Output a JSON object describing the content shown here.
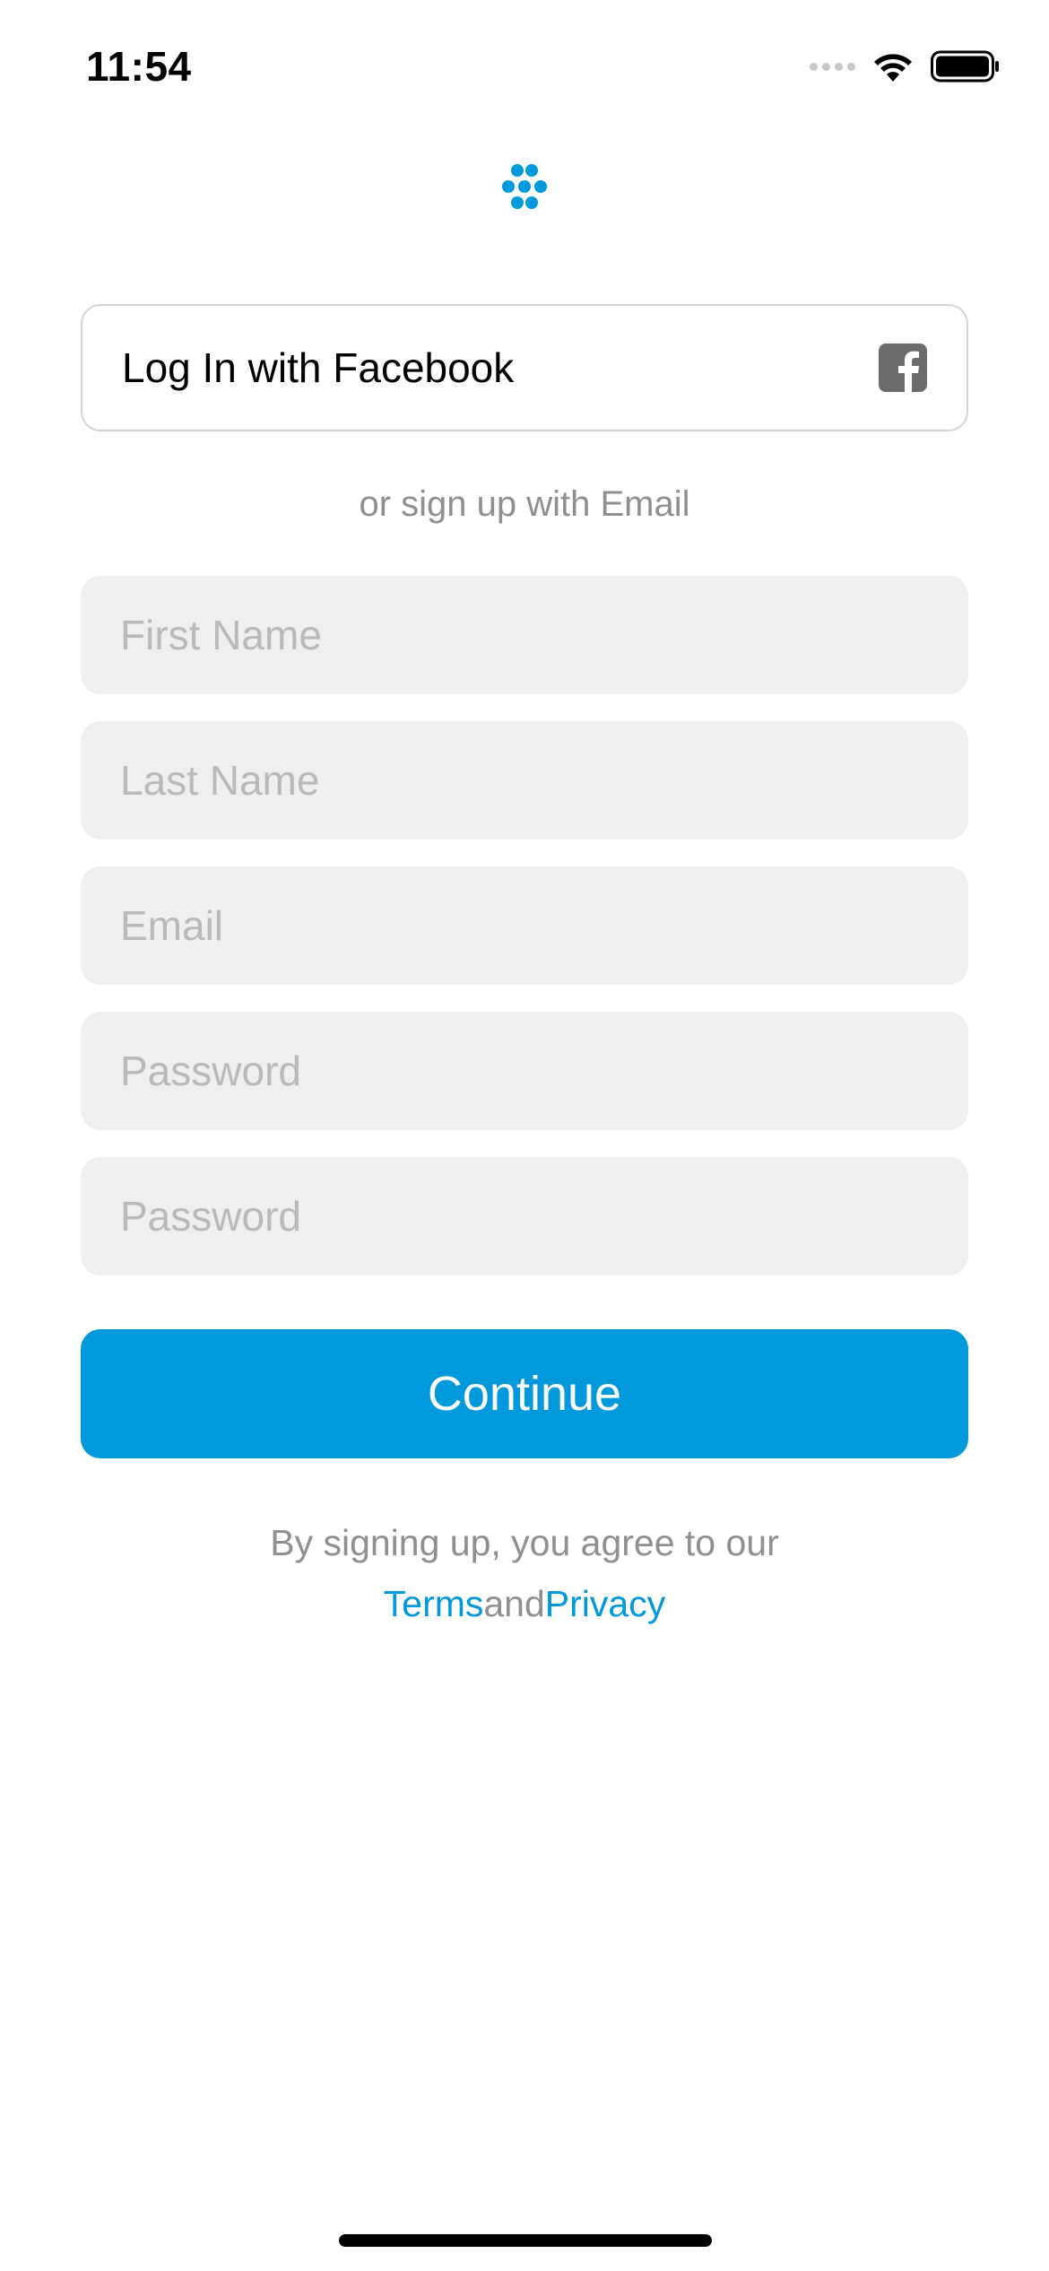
{
  "status_bar": {
    "time": "11:54"
  },
  "logo": {
    "icon": "flower-dots-icon",
    "color": "#0099dc"
  },
  "facebook_button": {
    "label": "Log In with Facebook",
    "icon": "facebook-icon"
  },
  "divider_text": "or sign up with Email",
  "form": {
    "first_name_placeholder": "First Name",
    "last_name_placeholder": "Last Name",
    "email_placeholder": "Email",
    "password_placeholder": "Password",
    "confirm_password_placeholder": "Password"
  },
  "continue_button": {
    "label": "Continue",
    "color": "#0099dc"
  },
  "legal": {
    "line1": "By signing up, you agree to our",
    "terms_link": "Terms",
    "and_text": "and",
    "privacy_link": "Privacy"
  }
}
